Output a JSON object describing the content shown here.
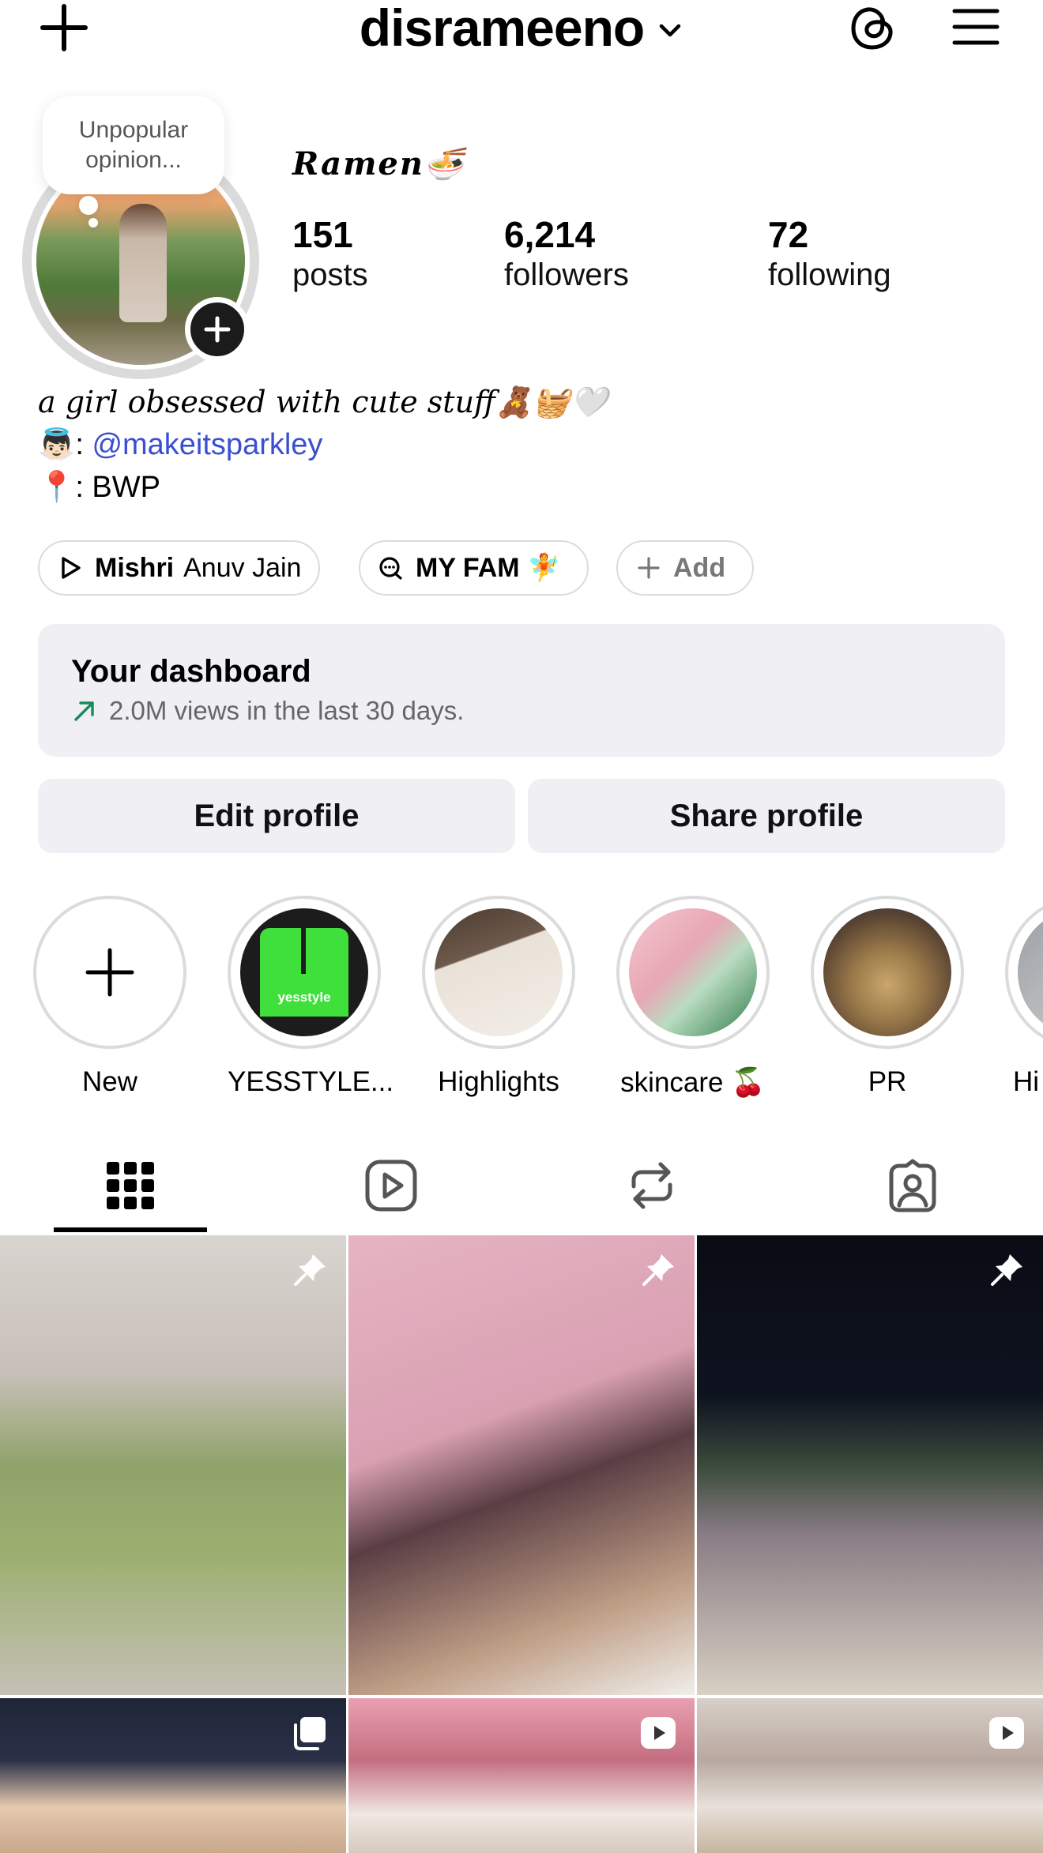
{
  "header": {
    "username": "disrameeno"
  },
  "profile": {
    "display_name": "Ramen🍜",
    "note": "Unpopular opinion...",
    "stats": [
      {
        "value": "151",
        "label": "posts"
      },
      {
        "value": "6,214",
        "label": "followers"
      },
      {
        "value": "72",
        "label": "following"
      }
    ],
    "bio": {
      "line1": "a girl obsessed with cute stuff🧸🧺🤍",
      "line2_prefix": "👼🏻: ",
      "mention": "@makeitsparkley",
      "line3": "📍: BWP"
    }
  },
  "chips": [
    {
      "bold": "Mishri",
      "rest": "Anuv Jain"
    },
    {
      "bold": "MY FAM 🧚",
      "rest": ""
    },
    {
      "bold": "",
      "rest": "Add"
    }
  ],
  "dashboard": {
    "title": "Your dashboard",
    "subtitle": "2.0M views in the last 30 days.",
    "accent": "#1a8a5a"
  },
  "buttons": {
    "edit": "Edit profile",
    "share": "Share profile"
  },
  "highlights": [
    {
      "label": "New"
    },
    {
      "label": "YESSTYLE..."
    },
    {
      "label": "Highlights"
    },
    {
      "label": "skincare 🍒"
    },
    {
      "label": "PR"
    },
    {
      "label": "Hi"
    }
  ],
  "highlight_yesstyle_logo_text": "yesstyle",
  "tabs": [
    "grid-icon",
    "reels-icon",
    "reposts-icon",
    "tagged-icon"
  ],
  "colors": {
    "mention": "#3b4fd1",
    "button_bg": "#efeff4",
    "border": "#dbdbdb"
  }
}
